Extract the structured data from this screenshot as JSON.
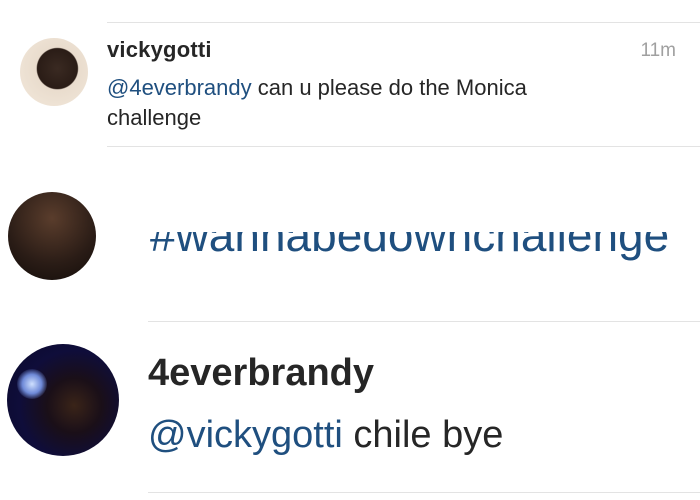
{
  "top_comment": {
    "username": "vickygotti",
    "time": "11m",
    "mention": "@4everbrandy",
    "text": " can u please do the Monica challenge"
  },
  "partial_comment": {
    "text": "#wannabedownchallenge"
  },
  "reply_comment": {
    "username": "4everbrandy",
    "mention": "@vickygotti",
    "text": " chile bye"
  },
  "colors": {
    "mention": "#1f4f7f",
    "text": "#262626",
    "muted": "#a0a0a0",
    "divider": "#e3e3e3"
  }
}
